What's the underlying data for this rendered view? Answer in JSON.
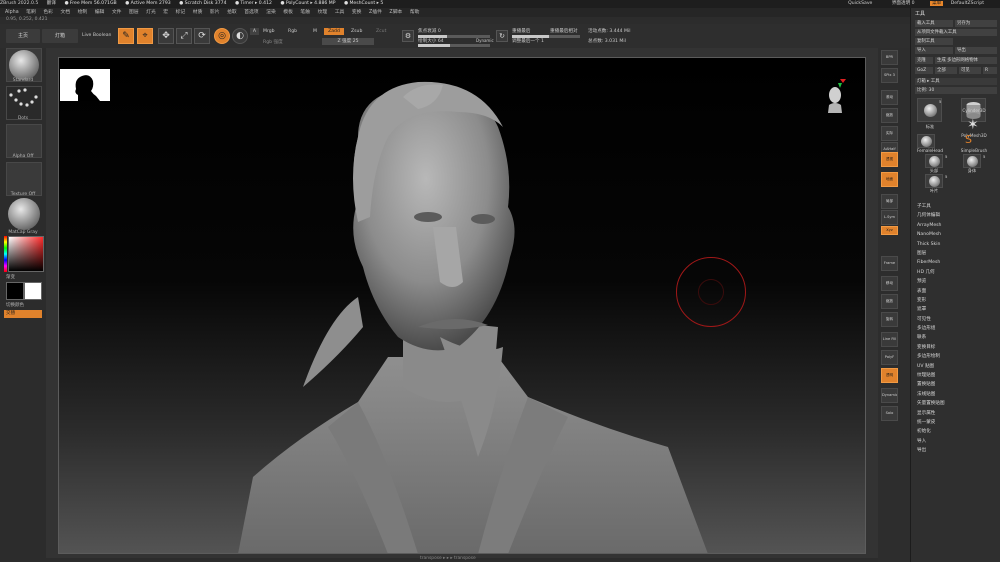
{
  "titlebar": {
    "items": [
      "ZBrush 2022.0.5",
      "翻译",
      "● Free Mem 56.071GB",
      "● Active Mem 2793",
      "● Scratch Disk 3774",
      "● Timer ▸ 0.412",
      "● PolyCount ▸ 4.886 MP",
      "● MeshCount ▸ 5"
    ],
    "quicksave": "QuickSave",
    "transparency": "界面透明 0",
    "menus_btn": "菜单",
    "script": "DefaultZScript"
  },
  "menubar": {
    "items": [
      "Alpha",
      "笔刷",
      "色彩",
      "文档",
      "绘制",
      "编辑",
      "文件",
      "图层",
      "灯光",
      "宏",
      "标记",
      "材质",
      "影片",
      "拾取",
      "首选项",
      "渲染",
      "模板",
      "笔触",
      "纹理",
      "工具",
      "变换",
      "Z插件",
      "Z脚本",
      "帮助"
    ]
  },
  "coords": "0.95, 0.252, 0.421",
  "toolbar": {
    "home": "主页",
    "lightbox": "灯箱",
    "live_boolean": "Live Boolean",
    "rgb_label": "Rgb",
    "mrgb_label": "Mrgb",
    "m_label": "M",
    "zadd": "Zadd",
    "zsub": "Zsub",
    "zcut": "Zcut",
    "rgb_intensity": "Rgb 强度",
    "z_intensity": "Z 强度 25",
    "focal_shift": "焦点衰减 0",
    "draw_size": "绘制大小 64",
    "dynamic": "Dynamic",
    "active_points": "活动点数: 3.444 Mil",
    "total_points": "总点数: 3.031 Mil",
    "sym_label": "重播最后",
    "replay_last_rel": "重播最后相对",
    "adj_last": "调整最后一个 1",
    "edit_label": "编辑",
    "draw_label": "绘制",
    "move_label": "移动",
    "scale_label": "缩放",
    "rotate_label": "旋转"
  },
  "leftshelf": {
    "brush": "Standard",
    "stroke": "Dots",
    "alpha": "Alpha Off",
    "texture": "Texture Off",
    "material": "MatCap Gray",
    "gradient": "渐变",
    "switch_color": "切换颜色",
    "alternate": "交替"
  },
  "rightshelf": {
    "buttons": [
      "BPR",
      "SPix 3",
      "滚动",
      "缩放",
      "实际",
      "AAHalf",
      "透视",
      "地面",
      "局部",
      "L.Sym",
      "Xyz",
      "Frame",
      "移动",
      "缩放",
      "旋转",
      "Line Fill",
      "PolyF",
      "透明",
      "Dynamic",
      "Solo"
    ],
    "active": [
      "透视",
      "地面",
      "Xyz"
    ]
  },
  "palette": {
    "title": "工具",
    "buttons": [
      "载入工具",
      "另存为",
      "从项目文件载入工具",
      "复制工具",
      "导入",
      "导出",
      "克隆",
      "生成 多边形网格物体",
      "GoZ",
      "全部",
      "可见",
      "R"
    ],
    "lightbox_tools": "灯箱 ▸ 工具",
    "ratio": "比例: 30",
    "tools": [
      {
        "name": "标准",
        "num": "5"
      },
      {
        "name": "Cylinder3D",
        "num": ""
      },
      {
        "name": "PolyMesh3D",
        "num": ""
      },
      {
        "name": "SimpleBrush",
        "num": ""
      },
      {
        "name": "FemaleHead",
        "num": ""
      },
      {
        "name": "头部",
        "num": "5"
      },
      {
        "name": "身体",
        "num": "5"
      },
      {
        "name": "叶片",
        "num": "5"
      }
    ],
    "subpalettes": [
      "子工具",
      "几何体编辑",
      "ArrayMesh",
      "NanoMesh",
      "Thick Skin",
      "图层",
      "FiberMesh",
      "HD 几何",
      "预览",
      "表面",
      "变形",
      "遮罩",
      "可见性",
      "多边形组",
      "联系",
      "变换目标",
      "多边形绘制",
      "UV 贴图",
      "纹理贴图",
      "置换贴图",
      "法线贴图",
      "矢量置换贴图",
      "显示属性",
      "统一蒙皮",
      "初始化",
      "导入",
      "导出"
    ]
  },
  "canvas": {
    "bottom_status": "transpose ▸ ▸ ▸ transpose"
  }
}
